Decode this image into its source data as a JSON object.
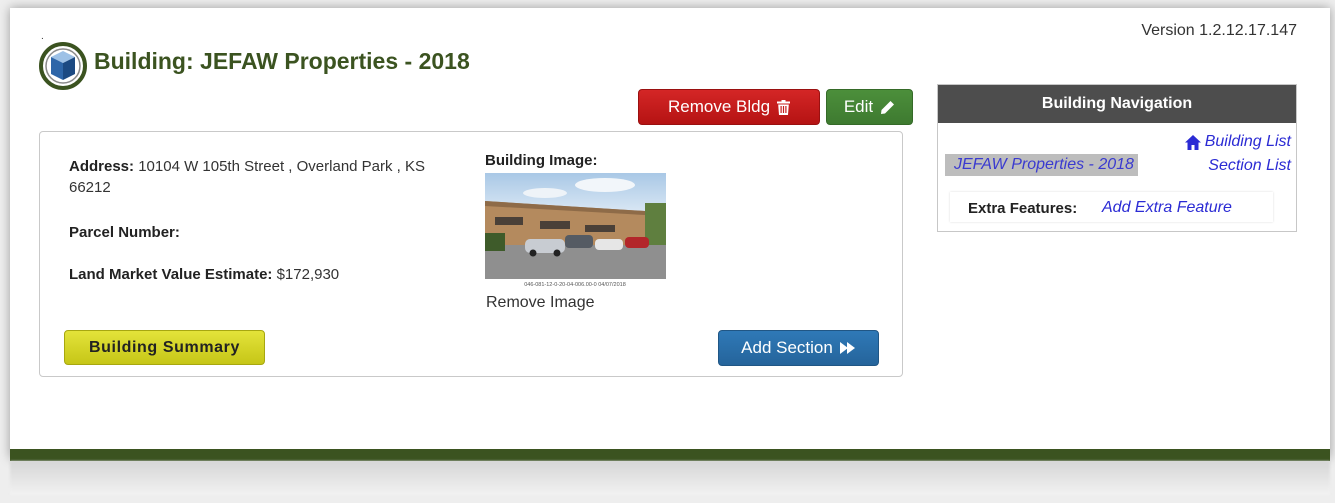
{
  "header": {
    "dot": ".",
    "version": "Version 1.2.12.17.147",
    "title": "Building: JEFAW Properties - 2018"
  },
  "toolbar": {
    "remove_label": "Remove Bldg",
    "remove_icon": "trash-icon",
    "edit_label": "Edit",
    "edit_icon": "pencil-icon"
  },
  "details": {
    "address_label": "Address:",
    "address_value": "10104 W 105th Street , Overland Park , KS 66212",
    "parcel_label": "Parcel Number:",
    "parcel_value": "",
    "land_label": "Land Market Value Estimate:",
    "land_value": "$172,930",
    "image_label": "Building Image:",
    "image_caption": "046-081-12-0-20-04-006.00-0 04/07/2018",
    "remove_image": "Remove Image"
  },
  "actions": {
    "summary_label": "Building Summary",
    "add_section_label": "Add Section",
    "add_section_icon": "fast-forward-icon"
  },
  "navigation": {
    "heading": "Building Navigation",
    "building_list": "Building List",
    "home_icon": "home-icon",
    "section_list": "Section List",
    "current": "JEFAW Properties - 2018",
    "extra_label": "Extra Features:",
    "extra_link": "Add Extra Feature"
  },
  "colors": {
    "title_green": "#3b5320",
    "remove_red": "#c41c1c",
    "edit_green": "#44843a",
    "add_blue": "#2a6fa8",
    "summary_yellow": "#d4d42a",
    "nav_header": "#4d4d4d",
    "link_blue": "#2b2bd4"
  }
}
